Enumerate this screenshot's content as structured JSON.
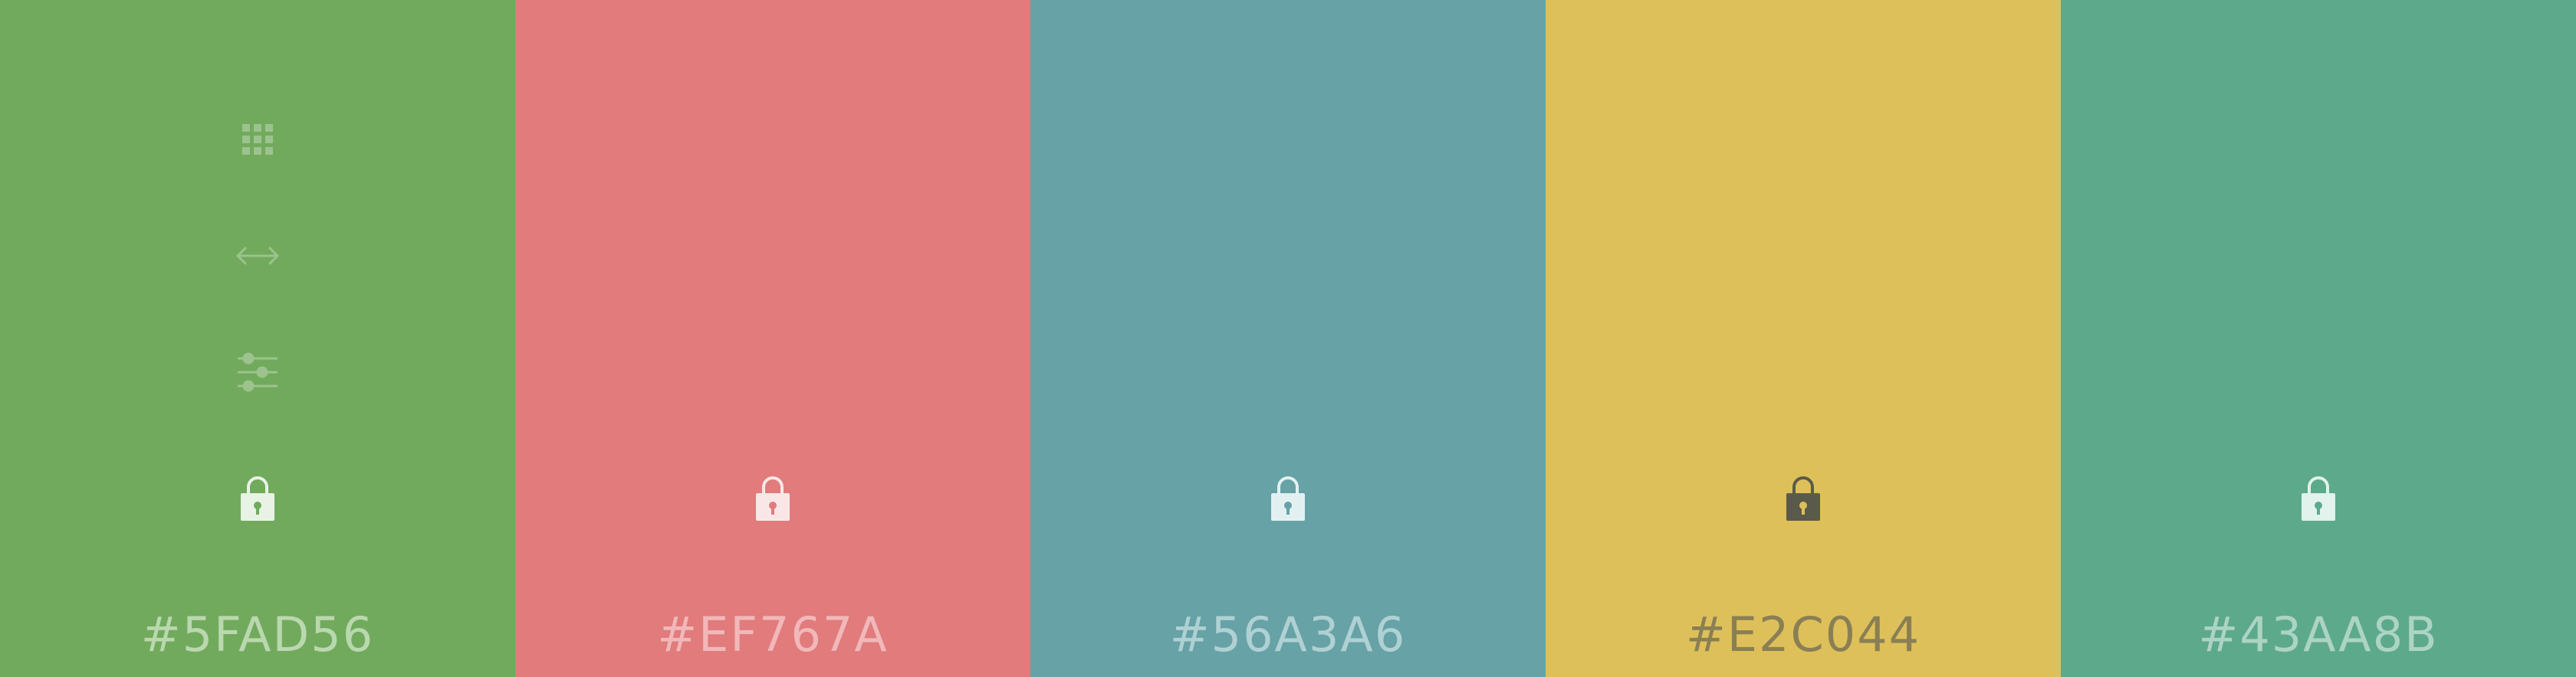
{
  "palette": {
    "colors": [
      {
        "hex": "#5FAD56",
        "bg": "#71AA5C",
        "lock_icon": "lock-icon",
        "lock_color": "#E8F3E5",
        "text_color": "#C2DDB8"
      },
      {
        "hex": "#EF767A",
        "bg": "#E17B7C",
        "lock_icon": "lock-icon",
        "lock_color": "#F9E7E7",
        "text_color": "#F4BFC0"
      },
      {
        "hex": "#56A3A6",
        "bg": "#66A2A6",
        "lock_icon": "lock-icon",
        "lock_color": "#E3F0F1",
        "text_color": "#B8D7D9"
      },
      {
        "hex": "#E2C044",
        "bg": "#DEC05A",
        "lock_icon": "lock-icon",
        "lock_color": "#5A5A4A",
        "text_color": "#6E6A52"
      },
      {
        "hex": "#43AA8B",
        "bg": "#5DA98C",
        "lock_icon": "lock-icon",
        "lock_color": "#E2F2EC",
        "text_color": "#B5D9CB"
      }
    ],
    "tool_icons": [
      "grid-icon",
      "resize-icon",
      "sliders-icon"
    ]
  }
}
